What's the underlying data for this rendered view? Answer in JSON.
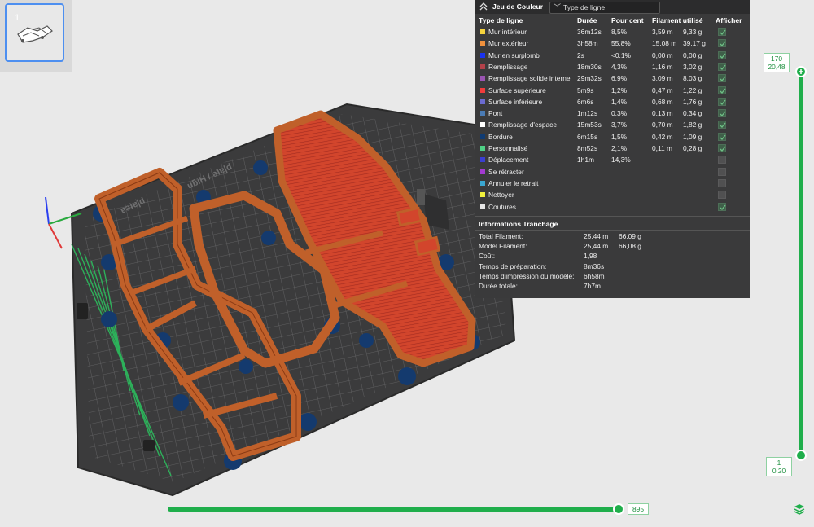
{
  "plate": {
    "index": "1"
  },
  "panel": {
    "title": "Jeu de Couleur",
    "view_select": "Type de ligne",
    "headers": {
      "type": "Type de ligne",
      "time": "Durée",
      "percent": "Pour cent",
      "filament": "Filament utilisé",
      "show": "Afficher"
    },
    "rows": [
      {
        "name": "Mur intérieur",
        "color": "#f5d33d",
        "time": "36m12s",
        "pct": "8,5%",
        "m": "3,59 m",
        "g": "9,33 g",
        "show": true,
        "has_cb": true
      },
      {
        "name": "Mur extérieur",
        "color": "#f0913d",
        "time": "3h58m",
        "pct": "55,8%",
        "m": "15,08 m",
        "g": "39,17 g",
        "show": true,
        "has_cb": true
      },
      {
        "name": "Mur en surplomb",
        "color": "#1a33f0",
        "time": "2s",
        "pct": "<0.1%",
        "m": "0,00 m",
        "g": "0,00 g",
        "show": true,
        "has_cb": true
      },
      {
        "name": "Remplissage",
        "color": "#b3414a",
        "time": "18m30s",
        "pct": "4,3%",
        "m": "1,16 m",
        "g": "3,02 g",
        "show": true,
        "has_cb": true
      },
      {
        "name": "Remplissage solide interne",
        "color": "#9b55b3",
        "time": "29m32s",
        "pct": "6,9%",
        "m": "3,09 m",
        "g": "8,03 g",
        "show": true,
        "has_cb": true
      },
      {
        "name": "Surface supérieure",
        "color": "#f03c3c",
        "time": "5m9s",
        "pct": "1,2%",
        "m": "0,47 m",
        "g": "1,22 g",
        "show": true,
        "has_cb": true
      },
      {
        "name": "Surface inférieure",
        "color": "#6b6bd1",
        "time": "6m6s",
        "pct": "1,4%",
        "m": "0,68 m",
        "g": "1,76 g",
        "show": true,
        "has_cb": true
      },
      {
        "name": "Pont",
        "color": "#4a7bb5",
        "time": "1m12s",
        "pct": "0,3%",
        "m": "0,13 m",
        "g": "0,34 g",
        "show": true,
        "has_cb": true
      },
      {
        "name": "Remplissage d'espace",
        "color": "#ffffff",
        "time": "15m53s",
        "pct": "3,7%",
        "m": "0,70 m",
        "g": "1,82 g",
        "show": true,
        "has_cb": true
      },
      {
        "name": "Bordure",
        "color": "#0f3b73",
        "time": "6m15s",
        "pct": "1,5%",
        "m": "0,42 m",
        "g": "1,09 g",
        "show": true,
        "has_cb": true
      },
      {
        "name": "Personnalisé",
        "color": "#4fd186",
        "time": "8m52s",
        "pct": "2,1%",
        "m": "0,11 m",
        "g": "0,28 g",
        "show": true,
        "has_cb": true
      },
      {
        "name": "Déplacement",
        "color": "#3a3fd1",
        "time": "1h1m",
        "pct": "14,3%",
        "m": "",
        "g": "",
        "show": false,
        "has_cb": true
      },
      {
        "name": "Se rétracter",
        "color": "#a33ad1",
        "time": "",
        "pct": "",
        "m": "",
        "g": "",
        "show": false,
        "has_cb": true
      },
      {
        "name": "Annuler le retrait",
        "color": "#3aa6d1",
        "time": "",
        "pct": "",
        "m": "",
        "g": "",
        "show": false,
        "has_cb": true
      },
      {
        "name": "Nettoyer",
        "color": "#f0f03c",
        "time": "",
        "pct": "",
        "m": "",
        "g": "",
        "show": false,
        "has_cb": true
      },
      {
        "name": "Coutures",
        "color": "#e6e6e6",
        "time": "",
        "pct": "",
        "m": "",
        "g": "",
        "show": true,
        "has_cb": true
      }
    ],
    "slicing": {
      "title": "Informations Tranchage",
      "items": [
        {
          "label": "Total Filament:",
          "v1": "25,44 m",
          "v2": "66,09 g"
        },
        {
          "label": "Model Filament:",
          "v1": "25,44 m",
          "v2": "66,08 g"
        },
        {
          "label": "Coût:",
          "v1": "1,98",
          "v2": ""
        },
        {
          "label": "Temps de préparation:",
          "v1": "8m36s",
          "v2": ""
        },
        {
          "label": "Temps d'impression du modèle:",
          "v1": "6h58m",
          "v2": ""
        },
        {
          "label": "Durée totale:",
          "v1": "7h7m",
          "v2": ""
        }
      ]
    }
  },
  "layer_slider": {
    "top_layer": "170",
    "top_height": "20,48",
    "bottom_layer": "1",
    "bottom_height": "0,20"
  },
  "move_slider": {
    "value": "895"
  },
  "colors": {
    "accent": "#1fae4b",
    "filament": "#c0602a",
    "plate": "#3d3d3e"
  }
}
